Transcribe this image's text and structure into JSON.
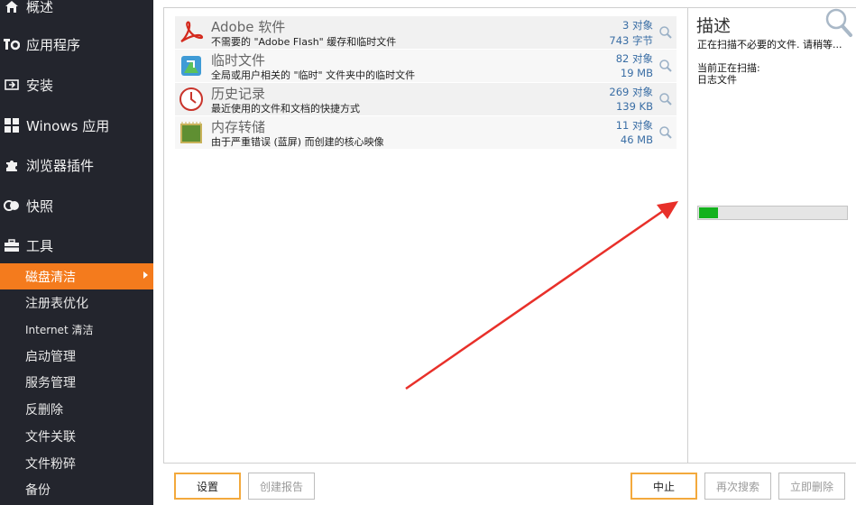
{
  "colors": {
    "sidebar_bg": "#23252d",
    "active_item": "#f47b1d",
    "accent_border": "#f3a93c",
    "progress_fill": "#13b21d",
    "annotation_arrow": "#e8302a",
    "count_text": "#3a6ea5"
  },
  "sidebar": {
    "nav": [
      {
        "label": "概述",
        "icon": "home-icon"
      },
      {
        "label": "应用程序",
        "icon": "apps-icon"
      },
      {
        "label": "安装",
        "icon": "install-icon"
      },
      {
        "label": "Winows 应用",
        "icon": "windows-icon"
      },
      {
        "label": "浏览器插件",
        "icon": "puzzle-icon"
      },
      {
        "label": "快照",
        "icon": "snapshot-icon"
      },
      {
        "label": "工具",
        "icon": "toolbox-icon"
      }
    ],
    "tools": [
      {
        "label": "磁盘清洁",
        "active": true
      },
      {
        "label": "注册表优化"
      },
      {
        "label": "Internet 清洁"
      },
      {
        "label": "启动管理"
      },
      {
        "label": "服务管理"
      },
      {
        "label": "反删除"
      },
      {
        "label": "文件关联"
      },
      {
        "label": "文件粉碎"
      },
      {
        "label": "备份"
      }
    ]
  },
  "items": [
    {
      "title": "Adobe 软件",
      "desc": "不需要的 \"Adobe Flash\" 缓存和临时文件",
      "count": "3 对象",
      "size": "743 字节",
      "icon": "adobe-icon"
    },
    {
      "title": "临时文件",
      "desc": "全局或用户相关的 \"临时\" 文件夹中的临时文件",
      "count": "82 对象",
      "size": "19 MB",
      "icon": "temp-files-icon"
    },
    {
      "title": "历史记录",
      "desc": "最近使用的文件和文档的快捷方式",
      "count": "269 对象",
      "size": "139 KB",
      "icon": "clock-icon"
    },
    {
      "title": "内存转储",
      "desc": "由于严重错误 (蓝屏) 而创建的核心映像",
      "count": "11 对象",
      "size": "46 MB",
      "icon": "memory-chip-icon"
    }
  ],
  "description": {
    "title": "描述",
    "scanning": "正在扫描不必要的文件. 请稍等...",
    "current_label": "当前正在扫描:",
    "current_file": "日志文件"
  },
  "progress": {
    "fraction": 0.13
  },
  "buttons": {
    "settings": "设置",
    "create_report": "创建报告",
    "stop": "中止",
    "rescan": "再次搜索",
    "delete_now": "立即删除"
  }
}
